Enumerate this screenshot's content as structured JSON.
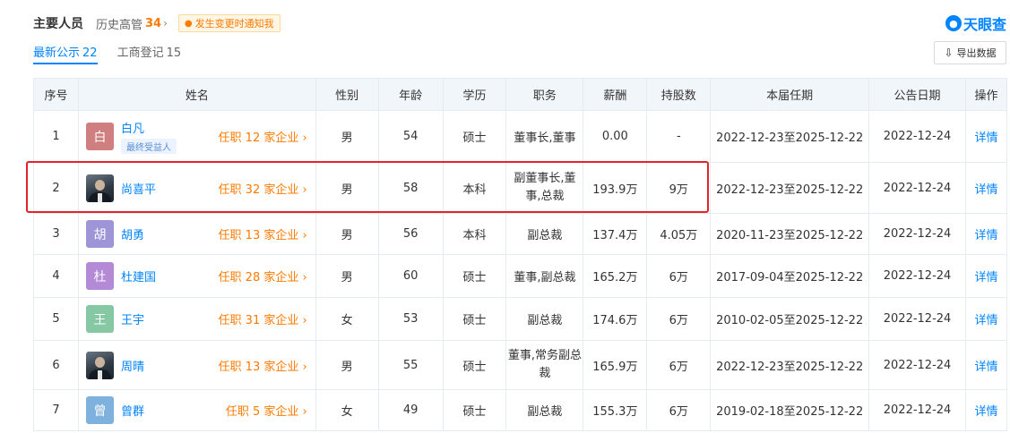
{
  "header": {
    "title": "主要人员",
    "history_label": "历史高管",
    "history_count": "34",
    "notify_label": "发生变更时通知我"
  },
  "logo": {
    "text": "天眼查"
  },
  "tabs": [
    {
      "label": "最新公示",
      "count": "22"
    },
    {
      "label": "工商登记",
      "count": "15"
    }
  ],
  "export_label": "导出数据",
  "columns": [
    "序号",
    "姓名",
    "性别",
    "年龄",
    "学历",
    "职务",
    "薪酬",
    "持股数",
    "本届任期",
    "公告日期",
    "操作"
  ],
  "rows": [
    {
      "seq": "1",
      "avatar_char": "白",
      "avatar_color": "#cf7f7f",
      "name": "白凡",
      "badge": "最终受益人",
      "jobs": "任职 12 家企业",
      "sex": "男",
      "age": "54",
      "edu": "硕士",
      "position": "董事长,董事",
      "salary": "0.00",
      "shares": "-",
      "term": "2022-12-23至2025-12-22",
      "date": "2022-12-24",
      "op": "详情"
    },
    {
      "seq": "2",
      "avatar_char": "",
      "avatar_color": "",
      "name": "尚喜平",
      "badge": "",
      "jobs": "任职 32 家企业",
      "sex": "男",
      "age": "58",
      "edu": "本科",
      "position": "副董事长,董事,总裁",
      "salary": "193.9万",
      "shares": "9万",
      "term": "2022-12-23至2025-12-22",
      "date": "2022-12-24",
      "op": "详情"
    },
    {
      "seq": "3",
      "avatar_char": "胡",
      "avatar_color": "#9d95d8",
      "name": "胡勇",
      "badge": "",
      "jobs": "任职 13 家企业",
      "sex": "男",
      "age": "56",
      "edu": "本科",
      "position": "副总裁",
      "salary": "137.4万",
      "shares": "4.05万",
      "term": "2020-11-23至2025-12-22",
      "date": "2022-12-24",
      "op": "详情"
    },
    {
      "seq": "4",
      "avatar_char": "杜",
      "avatar_color": "#b48ad6",
      "name": "杜建国",
      "badge": "",
      "jobs": "任职 28 家企业",
      "sex": "男",
      "age": "60",
      "edu": "硕士",
      "position": "董事,副总裁",
      "salary": "165.2万",
      "shares": "6万",
      "term": "2017-09-04至2025-12-22",
      "date": "2022-12-24",
      "op": "详情"
    },
    {
      "seq": "5",
      "avatar_char": "王",
      "avatar_color": "#86c7a4",
      "name": "王宇",
      "badge": "",
      "jobs": "任职 31 家企业",
      "sex": "女",
      "age": "53",
      "edu": "硕士",
      "position": "副总裁",
      "salary": "174.6万",
      "shares": "6万",
      "term": "2010-02-05至2025-12-22",
      "date": "2022-12-24",
      "op": "详情"
    },
    {
      "seq": "6",
      "avatar_char": "",
      "avatar_color": "",
      "name": "周晴",
      "badge": "",
      "jobs": "任职 13 家企业",
      "sex": "男",
      "age": "55",
      "edu": "硕士",
      "position": "董事,常务副总裁",
      "salary": "165.9万",
      "shares": "6万",
      "term": "2022-12-23至2025-12-22",
      "date": "2022-12-24",
      "op": "详情"
    },
    {
      "seq": "7",
      "avatar_char": "曾",
      "avatar_color": "#7fb1de",
      "name": "曾群",
      "badge": "",
      "jobs": "任职 5 家企业",
      "sex": "女",
      "age": "49",
      "edu": "硕士",
      "position": "副总裁",
      "salary": "155.3万",
      "shares": "6万",
      "term": "2019-02-18至2025-12-22",
      "date": "2022-12-24",
      "op": "详情"
    }
  ]
}
